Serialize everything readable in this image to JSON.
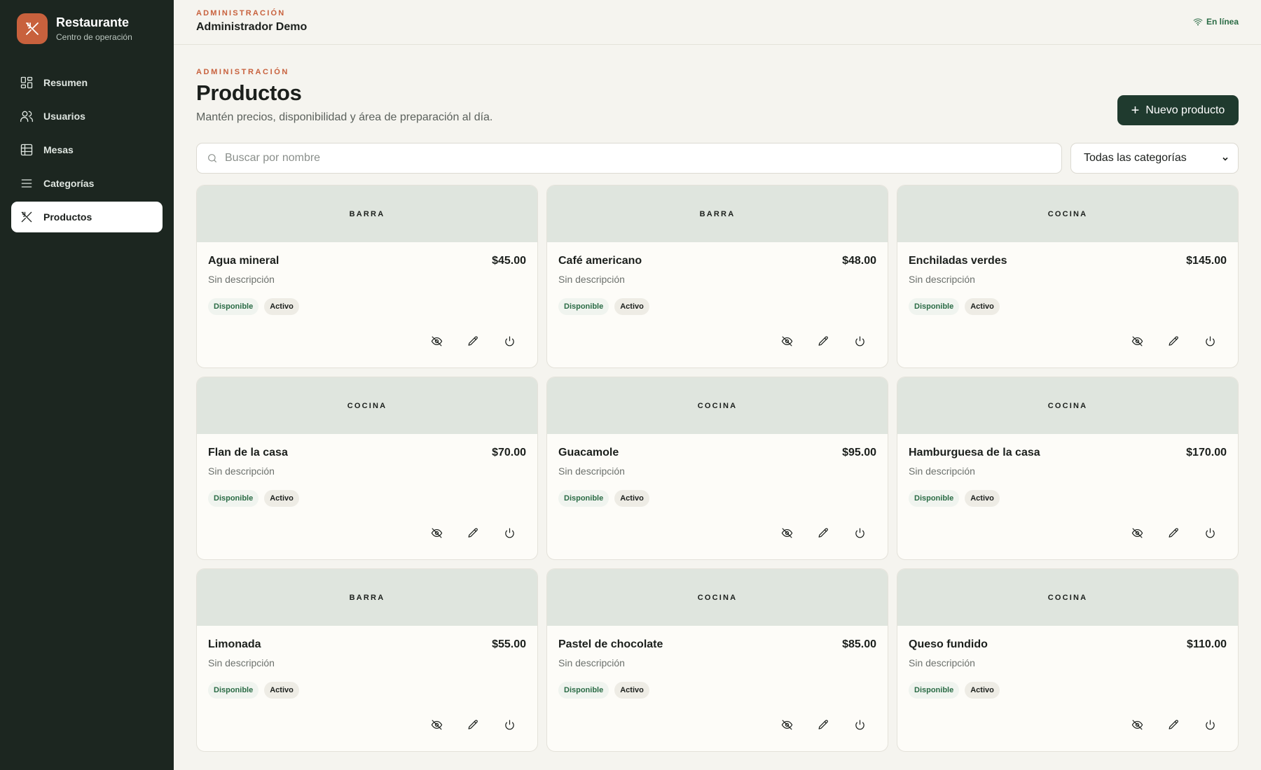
{
  "app": {
    "name": "Restaurante",
    "subtitle": "Centro de operación",
    "logo_icon": "utensils-icon",
    "brand_color": "#c8613d"
  },
  "sidebar": {
    "items": [
      {
        "label": "Resumen",
        "icon": "dashboard-icon",
        "active": false
      },
      {
        "label": "Usuarios",
        "icon": "users-icon",
        "active": false
      },
      {
        "label": "Mesas",
        "icon": "table-icon",
        "active": false
      },
      {
        "label": "Categorías",
        "icon": "list-icon",
        "active": false
      },
      {
        "label": "Productos",
        "icon": "utensils-icon",
        "active": true
      }
    ]
  },
  "topbar": {
    "eyebrow": "ADMINISTRACIÓN",
    "user": "Administrador Demo",
    "status": "En línea",
    "status_icon": "wifi-icon"
  },
  "page": {
    "eyebrow": "ADMINISTRACIÓN",
    "title": "Productos",
    "subtitle": "Mantén precios, disponibilidad y área de preparación al día.",
    "new_button": "Nuevo producto"
  },
  "filters": {
    "search_placeholder": "Buscar por nombre",
    "search_value": "",
    "category_selected": "Todas las categorías"
  },
  "products": [
    {
      "area": "BARRA",
      "name": "Agua mineral",
      "price": "$45.00",
      "description": "Sin descripción",
      "availability": "Disponible",
      "state": "Activo"
    },
    {
      "area": "BARRA",
      "name": "Café americano",
      "price": "$48.00",
      "description": "Sin descripción",
      "availability": "Disponible",
      "state": "Activo"
    },
    {
      "area": "COCINA",
      "name": "Enchiladas verdes",
      "price": "$145.00",
      "description": "Sin descripción",
      "availability": "Disponible",
      "state": "Activo"
    },
    {
      "area": "COCINA",
      "name": "Flan de la casa",
      "price": "$70.00",
      "description": "Sin descripción",
      "availability": "Disponible",
      "state": "Activo"
    },
    {
      "area": "COCINA",
      "name": "Guacamole",
      "price": "$95.00",
      "description": "Sin descripción",
      "availability": "Disponible",
      "state": "Activo"
    },
    {
      "area": "COCINA",
      "name": "Hamburguesa de la casa",
      "price": "$170.00",
      "description": "Sin descripción",
      "availability": "Disponible",
      "state": "Activo"
    },
    {
      "area": "BARRA",
      "name": "Limonada",
      "price": "$55.00",
      "description": "Sin descripción",
      "availability": "Disponible",
      "state": "Activo"
    },
    {
      "area": "COCINA",
      "name": "Pastel de chocolate",
      "price": "$85.00",
      "description": "Sin descripción",
      "availability": "Disponible",
      "state": "Activo"
    },
    {
      "area": "COCINA",
      "name": "Queso fundido",
      "price": "$110.00",
      "description": "Sin descripción",
      "availability": "Disponible",
      "state": "Activo"
    }
  ]
}
